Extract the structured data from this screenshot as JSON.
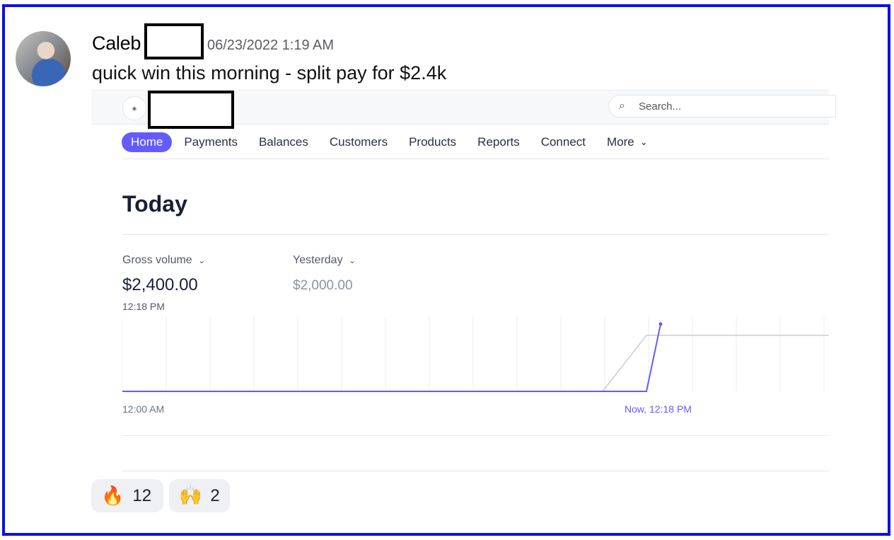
{
  "message": {
    "author": "Caleb",
    "timestamp": "06/23/2022 1:19 AM",
    "text": "quick win this morning - split pay for $2.4k"
  },
  "dashboard": {
    "search_placeholder": "Search...",
    "nav": [
      {
        "label": "Home",
        "active": true
      },
      {
        "label": "Payments"
      },
      {
        "label": "Balances"
      },
      {
        "label": "Customers"
      },
      {
        "label": "Products"
      },
      {
        "label": "Reports"
      },
      {
        "label": "Connect"
      },
      {
        "label": "More"
      }
    ],
    "heading": "Today",
    "gross_volume_label": "Gross volume",
    "gross_volume_value": "$2,400.00",
    "gross_volume_time": "12:18 PM",
    "yesterday_label": "Yesterday",
    "yesterday_value": "$2,000.00",
    "x_start": "12:00 AM",
    "x_now": "Now, 12:18 PM",
    "accent": "#635bff"
  },
  "chart_data": {
    "type": "line",
    "x": [
      "12:00 AM",
      "11:00 AM",
      "12:00 PM",
      "12:18 PM",
      "end of day"
    ],
    "series": [
      {
        "name": "Gross volume",
        "x": [
          "12:00 AM",
          "12:00 PM",
          "12:18 PM"
        ],
        "values": [
          0,
          0,
          2400
        ]
      },
      {
        "name": "Yesterday",
        "x": [
          "12:00 AM",
          "11:00 AM",
          "12:00 PM",
          "end of day"
        ],
        "values": [
          0,
          0,
          2000,
          2000
        ]
      }
    ],
    "grid": true
  },
  "reactions": [
    {
      "emoji": "fire-emoji",
      "count": "12"
    },
    {
      "emoji": "raised-hands-emoji",
      "count": "2"
    }
  ]
}
